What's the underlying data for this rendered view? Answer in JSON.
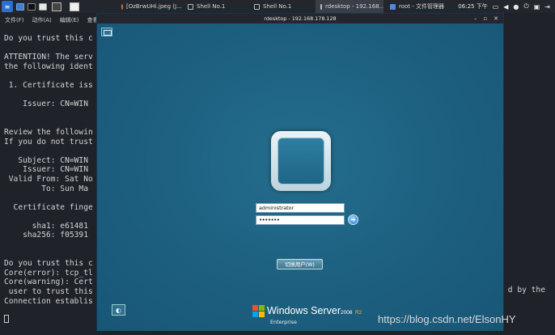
{
  "top_panel": {
    "tasks": [
      {
        "label": "[OzBrwUHi.jpeg (J..."
      },
      {
        "label": "Shell No.1"
      },
      {
        "label": "Shell No.1"
      },
      {
        "label": "rdesktop - 192.168...."
      },
      {
        "label": "root - 文件管理器"
      }
    ],
    "clock": "06:25 下午"
  },
  "terminal": {
    "menu": [
      "文件(F)",
      "动作(A)",
      "编辑(E)",
      "查看"
    ],
    "lines_text": "Do you trust this c\n\nATTENTION! The serv\nthe following ident\n\n 1. Certificate iss\n\n    Issuer: CN=WIN\n\n\nReview the followin\nIf you do not trust\n\n   Subject: CN=WIN\n    Issuer: CN=WIN\n Valid From: Sat No\n        To: Sun Ma\n\n  Certificate finge\n\n      sha1: e61481\n    sha256: f05391\n\n\nDo you trust this c\nCore(error): tcp_tl\nCore(warning): Cert\n user to trust this\nConnection establis",
    "right_fragment": "d by the"
  },
  "rdesktop": {
    "title": "rdesktop - 192.168.178.128",
    "username_value": "administrator",
    "password_value": "•••••••",
    "switch_user_label": "切换用户(W)",
    "brand": {
      "name": "Windows Server",
      "version": "2008",
      "release": "R2",
      "edition": "Enterprise"
    }
  },
  "watermark": "https://blog.csdn.net/ElsonHY",
  "colors": {
    "desktop_teal": "#1f5f7e",
    "panel_dark": "#23262c",
    "terminal_bg": "#1f2229"
  }
}
